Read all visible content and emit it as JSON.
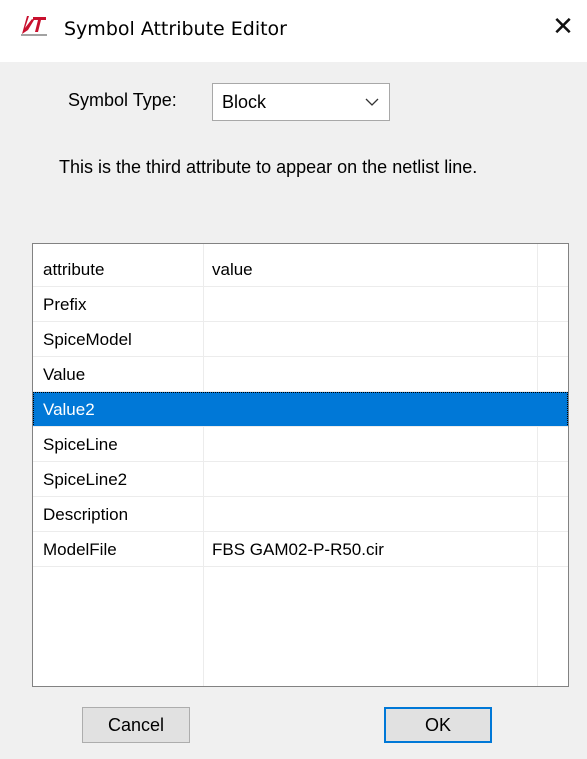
{
  "window": {
    "title": "Symbol Attribute Editor",
    "app_icon": "ltspice-icon",
    "close_glyph": "✕"
  },
  "symbol_type": {
    "label": "Symbol Type:",
    "selected": "Block"
  },
  "description": "This is the third attribute to appear on the netlist line.",
  "table": {
    "columns": [
      "attribute",
      "value"
    ],
    "rows": [
      {
        "attribute": "Prefix",
        "value": ""
      },
      {
        "attribute": "SpiceModel",
        "value": ""
      },
      {
        "attribute": "Value",
        "value": ""
      },
      {
        "attribute": "Value2",
        "value": "",
        "selected": true
      },
      {
        "attribute": "SpiceLine",
        "value": ""
      },
      {
        "attribute": "SpiceLine2",
        "value": ""
      },
      {
        "attribute": "Description",
        "value": ""
      },
      {
        "attribute": "ModelFile",
        "value": "FBS GAM02-P-R50.cir"
      }
    ]
  },
  "buttons": {
    "cancel": "Cancel",
    "ok": "OK"
  },
  "colors": {
    "selection": "#0078d7",
    "dialog_bg": "#f0f0f0",
    "icon_red": "#c8102e"
  }
}
